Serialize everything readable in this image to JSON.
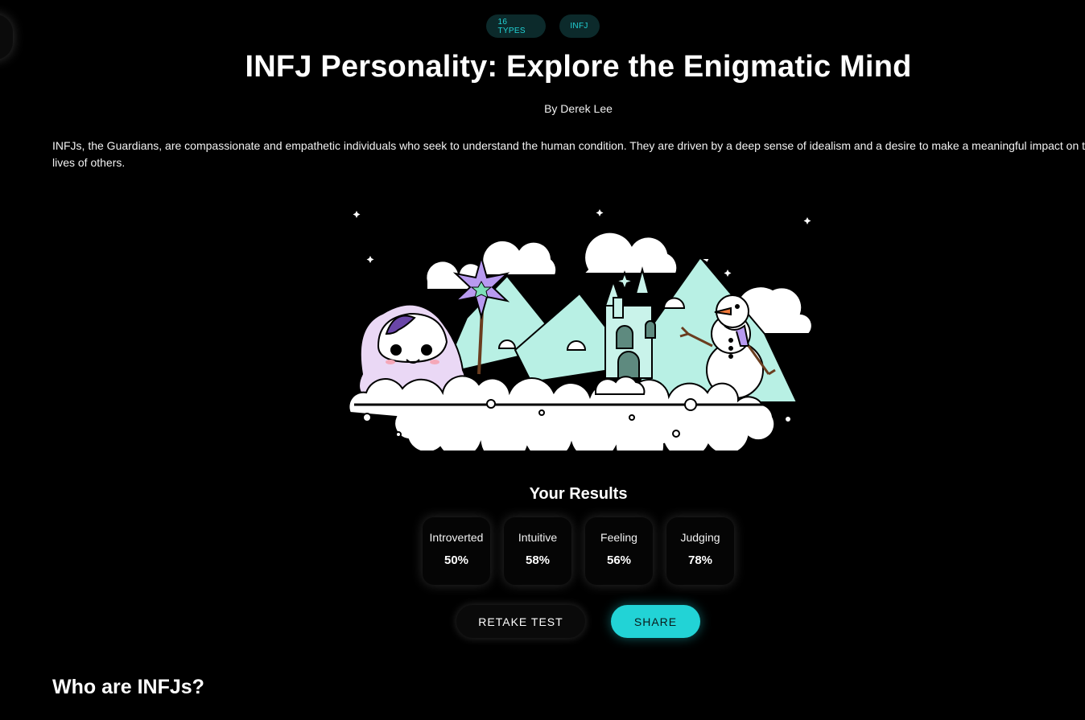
{
  "tags": [
    "16 TYPES",
    "INFJ"
  ],
  "article": {
    "title": "INFJ Personality: Explore the Enigmatic Mind",
    "byline": "By Derek Lee",
    "intro": "INFJs, the Guardians, are compassionate and empathetic individuals who seek to understand the human condition. They are driven by a deep sense of idealism and a desire to make a meaningful impact on the lives of others."
  },
  "results": {
    "title": "Your Results",
    "traits": [
      {
        "label": "Introverted",
        "value": "50%"
      },
      {
        "label": "Intuitive",
        "value": "58%"
      },
      {
        "label": "Feeling",
        "value": "56%"
      },
      {
        "label": "Judging",
        "value": "78%"
      }
    ]
  },
  "actions": {
    "retake": "RETAKE TEST",
    "share": "SHARE"
  },
  "section": {
    "heading": "Who are INFJs?"
  },
  "colors": {
    "accent": "#22d3d6",
    "tag_bg": "#0c2a2b",
    "background": "#000000",
    "mountain": "#b8f0e4",
    "wizard_robe": "#ead8f5",
    "wizard_star": "#b89af0"
  },
  "illustration": {
    "subject": "wizard character with star wand, ice castle, mountains and snowman on clouds"
  }
}
